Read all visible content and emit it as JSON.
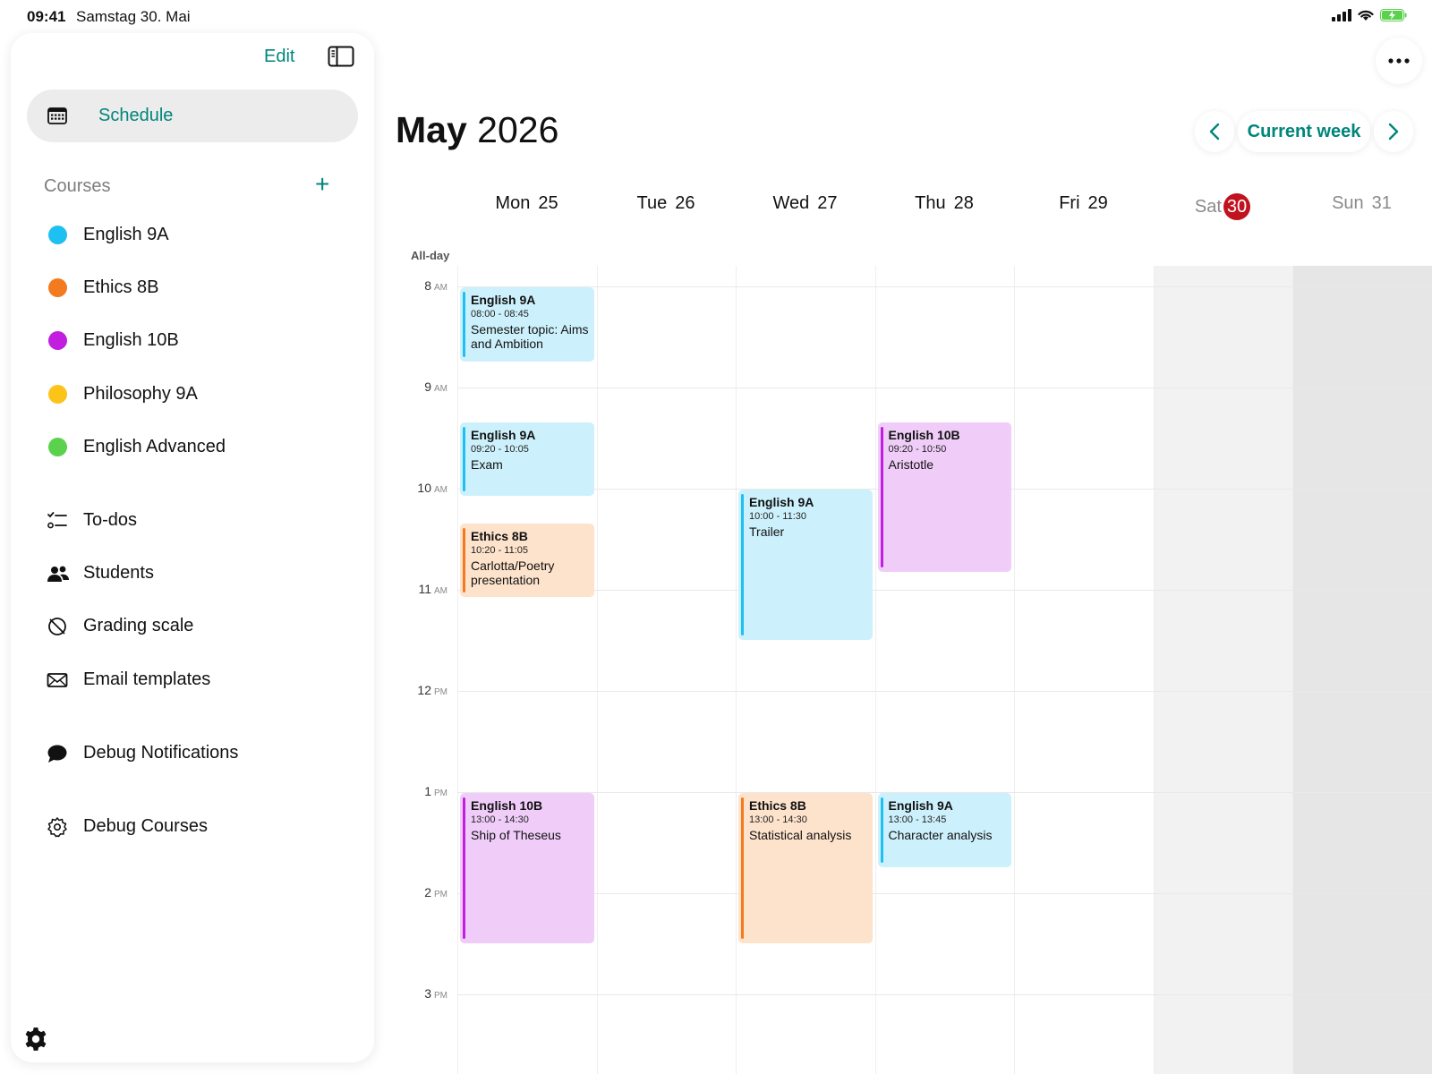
{
  "status_bar": {
    "time": "09:41",
    "date": "Samstag 30. Mai"
  },
  "sidebar": {
    "edit_label": "Edit",
    "schedule_label": "Schedule",
    "courses_heading": "Courses",
    "add_label": "+",
    "courses": [
      {
        "name": "English 9A",
        "color": "#1ec0f2"
      },
      {
        "name": "Ethics 8B",
        "color": "#f47a1f"
      },
      {
        "name": "English 10B",
        "color": "#c21ee0"
      },
      {
        "name": "Philosophy 9A",
        "color": "#fcc419"
      },
      {
        "name": "English Advanced",
        "color": "#5bd24e"
      }
    ],
    "nav": [
      {
        "label": "To-dos",
        "icon": "todo-list-icon"
      },
      {
        "label": "Students",
        "icon": "people-icon"
      },
      {
        "label": "Grading scale",
        "icon": "grading-scale-icon"
      },
      {
        "label": "Email templates",
        "icon": "envelope-icon"
      },
      {
        "label": "Debug Notifications",
        "icon": "speech-bubble-icon"
      },
      {
        "label": "Debug Courses",
        "icon": "gear-outline-icon"
      }
    ]
  },
  "header": {
    "month": "May",
    "year": "2026",
    "current_week_label": "Current week",
    "prev_icon": "chevron-left-icon",
    "next_icon": "chevron-right-icon",
    "more_icon": "ellipsis-icon"
  },
  "calendar": {
    "all_day_label": "All-day",
    "days": [
      {
        "name": "Mon",
        "num": "25",
        "weekend": false,
        "today": false
      },
      {
        "name": "Tue",
        "num": "26",
        "weekend": false,
        "today": false
      },
      {
        "name": "Wed",
        "num": "27",
        "weekend": false,
        "today": false
      },
      {
        "name": "Thu",
        "num": "28",
        "weekend": false,
        "today": false
      },
      {
        "name": "Fri",
        "num": "29",
        "weekend": false,
        "today": false
      },
      {
        "name": "Sat",
        "num": "30",
        "weekend": true,
        "today": true
      },
      {
        "name": "Sun",
        "num": "31",
        "weekend": true,
        "today": false
      }
    ],
    "hours": [
      {
        "h": "8",
        "ap": "AM"
      },
      {
        "h": "9",
        "ap": "AM"
      },
      {
        "h": "10",
        "ap": "AM"
      },
      {
        "h": "11",
        "ap": "AM"
      },
      {
        "h": "12",
        "ap": "PM"
      },
      {
        "h": "1",
        "ap": "PM"
      },
      {
        "h": "2",
        "ap": "PM"
      },
      {
        "h": "3",
        "ap": "PM"
      }
    ],
    "today_color": "#c1121f",
    "events": [
      {
        "day": 0,
        "title": "English 9A",
        "time": "08:00 - 08:45",
        "desc": "Semester topic: Aims and Ambition",
        "start": "08:00",
        "end": "08:45",
        "bg": "#cdf1fc",
        "accent": "#1ec0f2"
      },
      {
        "day": 0,
        "title": "English 9A",
        "time": "09:20 - 10:05",
        "desc": "Exam",
        "start": "09:20",
        "end": "10:05",
        "bg": "#cdf1fc",
        "accent": "#1ec0f2"
      },
      {
        "day": 0,
        "title": "Ethics 8B",
        "time": "10:20 - 11:05",
        "desc": "Carlotta/Poetry presentation",
        "start": "10:20",
        "end": "11:05",
        "bg": "#fde2cc",
        "accent": "#f47a1f"
      },
      {
        "day": 0,
        "title": "English 10B",
        "time": "13:00 - 14:30",
        "desc": "Ship of Theseus",
        "start": "13:00",
        "end": "14:30",
        "bg": "#f0cdf9",
        "accent": "#c21ee0"
      },
      {
        "day": 2,
        "title": "English 9A",
        "time": "10:00 - 11:30",
        "desc": "Trailer",
        "start": "10:00",
        "end": "11:30",
        "bg": "#cdf1fc",
        "accent": "#1ec0f2"
      },
      {
        "day": 2,
        "title": "Ethics 8B",
        "time": "13:00 - 14:30",
        "desc": "Statistical analysis",
        "start": "13:00",
        "end": "14:30",
        "bg": "#fde2cc",
        "accent": "#f47a1f"
      },
      {
        "day": 3,
        "title": "English 10B",
        "time": "09:20 - 10:50",
        "desc": "Aristotle",
        "start": "09:20",
        "end": "10:50",
        "bg": "#f0cdf9",
        "accent": "#c21ee0"
      },
      {
        "day": 3,
        "title": "English 9A",
        "time": "13:00 - 13:45",
        "desc": "Character analysis",
        "start": "13:00",
        "end": "13:45",
        "bg": "#cdf1fc",
        "accent": "#1ec0f2"
      }
    ]
  }
}
